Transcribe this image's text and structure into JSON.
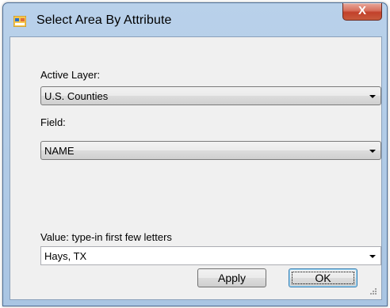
{
  "window": {
    "title": "Select Area By Attribute",
    "close_label": "X"
  },
  "form": {
    "active_layer": {
      "label": "Active Layer:",
      "value": "U.S. Counties"
    },
    "field": {
      "label": "Field:",
      "value": "NAME"
    },
    "value": {
      "label": "Value: type-in first few letters",
      "value": "Hays, TX"
    }
  },
  "buttons": {
    "apply": "Apply",
    "ok": "OK"
  },
  "icons": {
    "app": "form-window-icon",
    "close": "close-icon",
    "dropdown": "chevron-down-icon",
    "resize": "resize-grip-icon"
  },
  "colors": {
    "titlebar": "#b9d1ea",
    "close": "#c2412b",
    "client": "#f0f0f0"
  }
}
